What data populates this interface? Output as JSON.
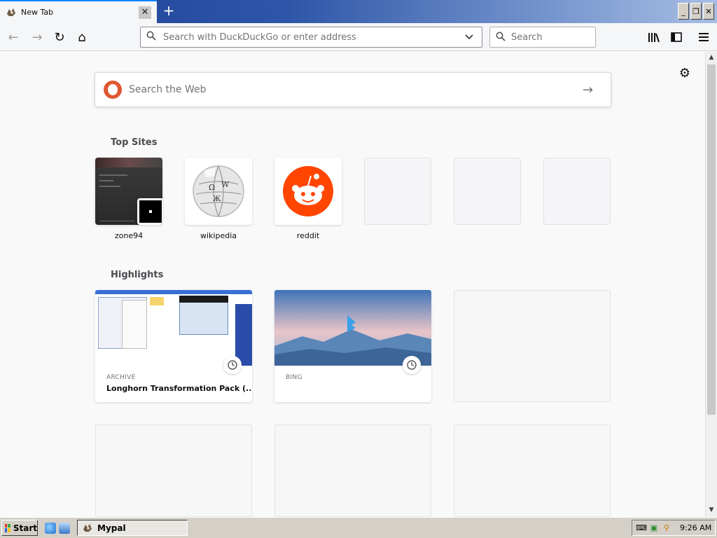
{
  "tab": {
    "title": "New Tab",
    "close_symbol": "✕",
    "favicon": "mypal-icon"
  },
  "new_tab_symbol": "+",
  "window_controls": {
    "minimize": "_",
    "restore": "❐",
    "close": "✕"
  },
  "nav": {
    "back": "←",
    "forward": "→",
    "reload": "↻",
    "home": "⌂",
    "url_placeholder": "Search with DuckDuckGo or enter address",
    "search_placeholder": "Search",
    "library": "|||\\",
    "sidebar": "▯",
    "menu": "≡"
  },
  "content": {
    "settings_icon": "⚙",
    "web_search_placeholder": "Search the Web",
    "web_search_arrow": "→",
    "top_sites_title": "Top Sites",
    "top_sites": [
      {
        "label": "zone94"
      },
      {
        "label": "wikipedia"
      },
      {
        "label": "reddit"
      }
    ],
    "highlights_title": "Highlights",
    "highlights": [
      {
        "source": "ARCHIVE",
        "title": "Longhorn Transformation Pack (..."
      },
      {
        "source": "BING",
        "title": ""
      }
    ]
  },
  "taskbar": {
    "start_label": "Start",
    "task_label": "Mypal",
    "time": "9:26 AM"
  },
  "colors": {
    "accent": "#0a84ff",
    "reddit": "#ff4500",
    "ddg": "#de5833",
    "titlebar": "#1d3f94"
  }
}
